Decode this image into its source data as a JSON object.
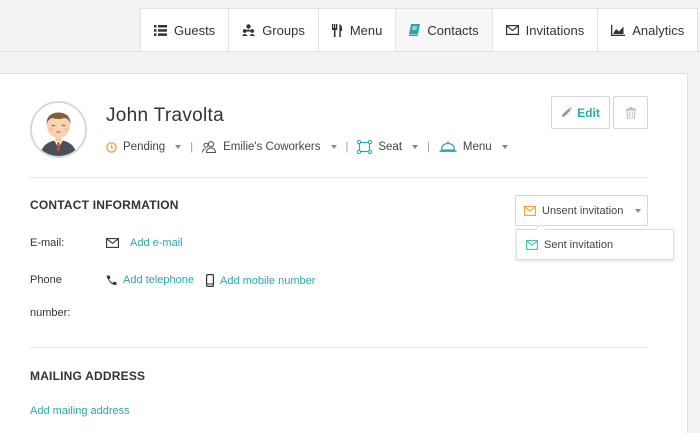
{
  "nav": {
    "tabs": [
      {
        "label": "Guests",
        "icon": "list-icon"
      },
      {
        "label": "Groups",
        "icon": "groups-icon"
      },
      {
        "label": "Menu",
        "icon": "cutlery-icon"
      },
      {
        "label": "Contacts",
        "icon": "book-icon",
        "active": true
      },
      {
        "label": "Invitations",
        "icon": "envelope-icon"
      },
      {
        "label": "Analytics",
        "icon": "chart-icon"
      }
    ]
  },
  "guest": {
    "name": "John Travolta",
    "status": "Pending",
    "group": "Emilie's Coworkers",
    "seat": "Seat",
    "menu": "Menu"
  },
  "actions": {
    "edit_label": "Edit"
  },
  "contact": {
    "title": "CONTACT INFORMATION",
    "invitation_selected": "Unsent invitation",
    "invitation_option": "Sent invitation",
    "email_label": "E-mail:",
    "add_email": "Add e-mail",
    "phone_label_1": "Phone",
    "phone_label_2": "number:",
    "add_telephone": "Add telephone",
    "add_mobile": "Add mobile number"
  },
  "mailing": {
    "title": "MAILING ADDRESS",
    "add_address": "Add mailing address"
  },
  "colors": {
    "accent": "#2aa6ae",
    "pending": "#f0a030",
    "envelope_orange": "#f0a030",
    "envelope_green": "#3fc1a8"
  }
}
